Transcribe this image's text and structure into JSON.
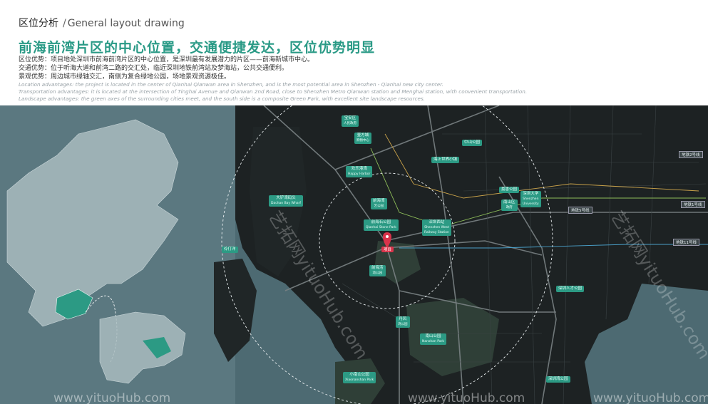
{
  "header": {
    "section_cn": "区位分析",
    "section_sep": "/",
    "section_en": "General layout drawing",
    "headline": "前海前湾片区的中心位置，交通便捷发达，区位优势明显",
    "desc_cn": [
      "区位优势：项目地处深圳市前海前湾片区的中心位置，是深圳最有发展潜力的片区——前海新城市中心。",
      "交通优势：位于听海大道和前湾二路的交汇处，临近深圳地铁前湾站及梦海站，公共交通便利。",
      "景观优势：周边城市绿轴交汇，南侧为复合绿地公园，场地景观资源极佳。"
    ],
    "desc_en": [
      "Location advantages: the project is located in the center of Qianhai Qianwan area in Shenzhen, and is the most potential area in Shenzhen - Qianhai new city center.",
      "Transportation advantages: it is located at the intersection of Tinghai Avenue and Qianwan 2nd Road, close to Shenzhen Metro Qianwan station and Menghai station, with convenient transportation.",
      "Landscape advantages: the green axes of the surrounding cities meet, and the south side is a composite Green Park, with excellent site landscape resources."
    ]
  },
  "map": {
    "colors": {
      "sea": "#4d6a72",
      "land": "#1d2223",
      "park": "#2f3f37",
      "accent": "#2c9a84",
      "pin": "#d8334a"
    },
    "pin_label": "项目",
    "labels": {
      "baoan_gov": [
        "宝安区",
        "人民政府"
      ],
      "mall": [
        "壹方城",
        "购物中心"
      ],
      "haiyue": [
        "海上世界小镇"
      ],
      "zhongshan": [
        "中山公园"
      ],
      "joy": [
        "欢乐港湾",
        "Happy Harbor"
      ],
      "qhbay_park": [
        "前海湾",
        "艺公园"
      ],
      "qhstone": [
        "前海石公园",
        "Qianhai Stone Park"
      ],
      "shenzhen_west": [
        "深圳西站",
        "Shenzhen West",
        "Railway Station"
      ],
      "dachan": [
        "大铲湾码头",
        "Dachan Bay Wharf"
      ],
      "lingding": [
        "伶仃洋"
      ],
      "qhpark": [
        "前海活",
        "动公园"
      ],
      "dannan": [
        "丹凤",
        "湾公园"
      ],
      "nanshan_park": [
        "南山公园",
        "Nanshan Park"
      ],
      "xiaonan": [
        "小南山公园",
        "Xiaonanshan Park"
      ],
      "nanshan_gov": [
        "南山区",
        "政府"
      ],
      "szu": [
        "深圳大学",
        "Shenzhen",
        "University"
      ],
      "tech": [
        "荔香公园"
      ],
      "talent": [
        "深圳人才公园"
      ],
      "szbay": [
        "深圳湾公园"
      ]
    },
    "tags": {
      "metro2": "地铁2号线",
      "metro1": "地铁1号线",
      "metro5": "地铁5号线",
      "metro11": "地铁11号线"
    },
    "watermarks": [
      "www.yituoHub.com",
      "www.yituoHub.com",
      "www.yituoHub.com"
    ],
    "watermarks_diag": [
      "艺拓网yituoHub.com",
      "艺拓网yituoHub.com"
    ]
  }
}
